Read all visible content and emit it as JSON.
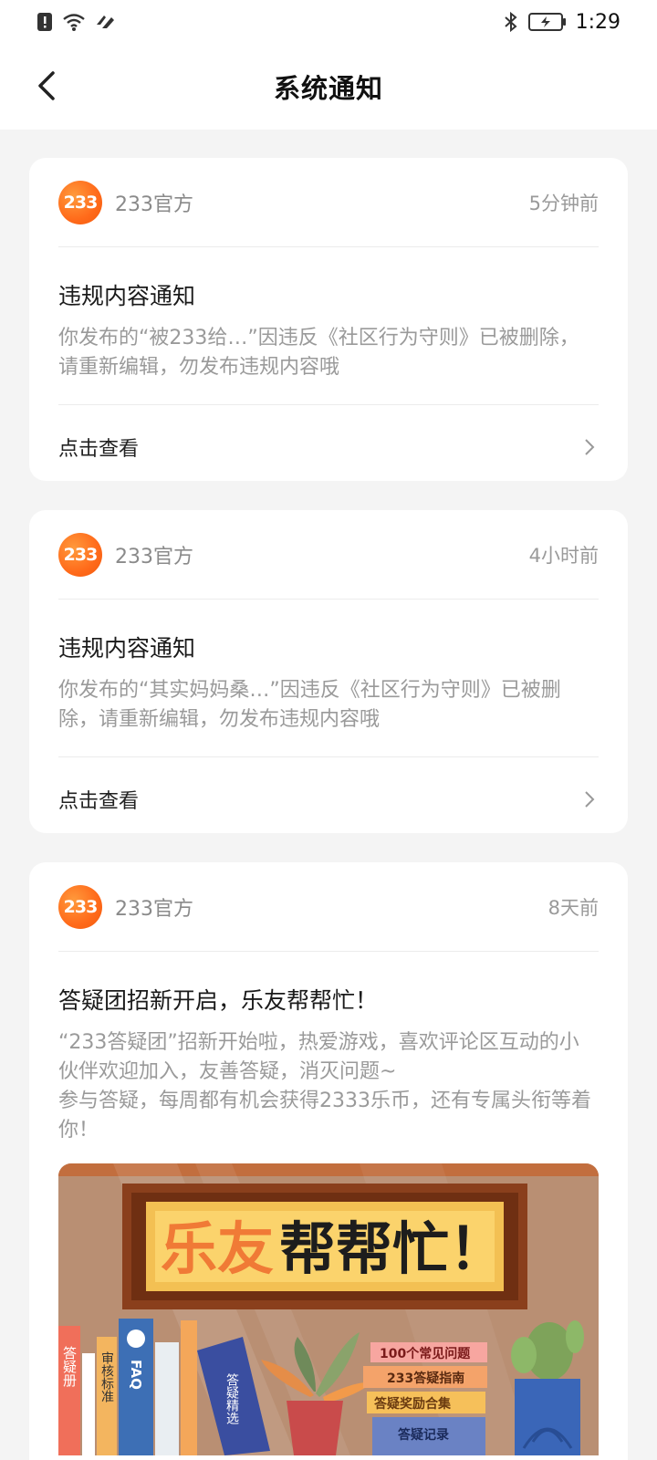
{
  "status_bar": {
    "time": "1:29"
  },
  "header": {
    "title": "系统通知"
  },
  "notifications": [
    {
      "author": "233官方",
      "logo_text": "233",
      "time": "5分钟前",
      "title": "违规内容通知",
      "lines": [
        "你发布的“被233给…”因违反《社区行为守则》已被删除，请重新编辑，勿发布违规内容哦"
      ],
      "action": "点击查看"
    },
    {
      "author": "233官方",
      "logo_text": "233",
      "time": "4小时前",
      "title": "违规内容通知",
      "lines": [
        "你发布的“其实妈妈桑…”因违反《社区行为守则》已被删除，请重新编辑，勿发布违规内容哦"
      ],
      "action": "点击查看"
    },
    {
      "author": "233官方",
      "logo_text": "233",
      "time": "8天前",
      "title": "答疑团招新开启，乐友帮帮忙！",
      "lines": [
        "“233答疑团”招新开始啦，热爱游戏，喜欢评论区互动的小伙伴欢迎加入，友善答疑，消灭问题~",
        "参与答疑，每周都有机会获得2333乐币，还有专属头衔等着你！"
      ],
      "banner": {
        "title_orange": "乐友",
        "title_dark": "帮帮忙！",
        "book_labels": [
          "答疑册",
          "审核标准",
          "FAQ",
          "答疑精选",
          "100个常见问题",
          "233答疑指南",
          "答疑奖励合集",
          "答疑记录"
        ]
      }
    }
  ],
  "colors": {
    "accent": "#ff6a1a",
    "card_bg": "#ffffff",
    "page_bg": "#f4f4f4"
  }
}
